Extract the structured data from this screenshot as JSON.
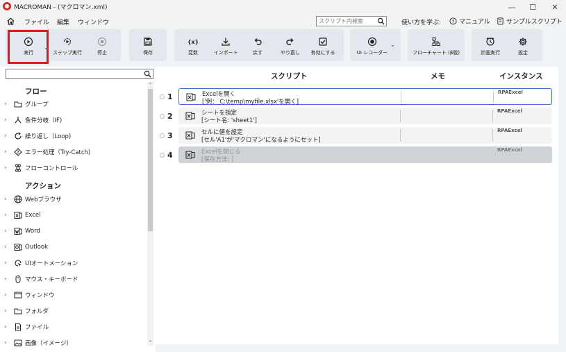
{
  "window": {
    "title": "MACROMAN - (マクロマン.xml)",
    "minimize": "—",
    "maximize": "☐",
    "close": "✕"
  },
  "menu": {
    "items": [
      "ファイル",
      "編集",
      "ウィンドウ"
    ],
    "search_placeholder": "スクリプト内検索",
    "learn_label": "使い方を学ぶ:",
    "manual": "マニュアル",
    "samples": "サンプルスクリプト"
  },
  "toolbar": {
    "run": "実行",
    "step_run": "ステップ実行",
    "stop": "停止",
    "save": "保存",
    "variable": "変数",
    "import": "インポート",
    "undo": "戻す",
    "redo": "やり直し",
    "enable": "有効にする",
    "ui_recorder": "UI レコーダー",
    "flowchart": "フローチャート (β版)",
    "schedule": "計画実行",
    "settings": "設定",
    "highlight_color": "#e0191b"
  },
  "sidebar": {
    "flow_heading": "フロー",
    "flow_items": [
      {
        "label": "グループ",
        "icon": "folder-icon"
      },
      {
        "label": "条件分岐（IF)",
        "icon": "branch-icon"
      },
      {
        "label": "繰り返し（Loop)",
        "icon": "loop-icon"
      },
      {
        "label": "エラー処理（Try-Catch)",
        "icon": "diamond-icon"
      },
      {
        "label": "フローコントロール",
        "icon": "command-icon"
      }
    ],
    "action_heading": "アクション",
    "action_items": [
      {
        "label": "Webブラウザ",
        "icon": "globe-icon"
      },
      {
        "label": "Excel",
        "icon": "excel-icon"
      },
      {
        "label": "Word",
        "icon": "word-icon"
      },
      {
        "label": "Outlook",
        "icon": "outlook-icon"
      },
      {
        "label": "UIオートメーション",
        "icon": "cursor-icon"
      },
      {
        "label": "マウス・キーボード",
        "icon": "mouse-icon"
      },
      {
        "label": "ウィンドウ",
        "icon": "window-icon"
      },
      {
        "label": "フォルダ",
        "icon": "folder-icon"
      },
      {
        "label": "ファイル",
        "icon": "file-icon"
      },
      {
        "label": "画像（イメージ）",
        "icon": "image-icon"
      }
    ]
  },
  "script": {
    "col_script": "スクリプト",
    "col_memo": "メモ",
    "col_instance": "インスタンス",
    "accent": "#3a6fd8",
    "rows": [
      {
        "num": "1",
        "line1": "Excelを開く",
        "line2": "['例： C:\\temp\\myfile.xlsx'を開く]",
        "instance": "RPAExcel",
        "state": "selected"
      },
      {
        "num": "2",
        "line1": "シートを指定",
        "line2": "[シート名: 'sheet1']",
        "instance": "RPAExcel",
        "state": "normal"
      },
      {
        "num": "3",
        "line1": "セルに値を設定",
        "line2": "[セル'A1'が'マクロマン'になるようにセット]",
        "instance": "RPAExcel",
        "state": "normal"
      },
      {
        "num": "4",
        "line1": "Excelを閉じる",
        "line2": "[保存方法: ]",
        "instance": "RPAExcel",
        "state": "disabled"
      }
    ]
  }
}
